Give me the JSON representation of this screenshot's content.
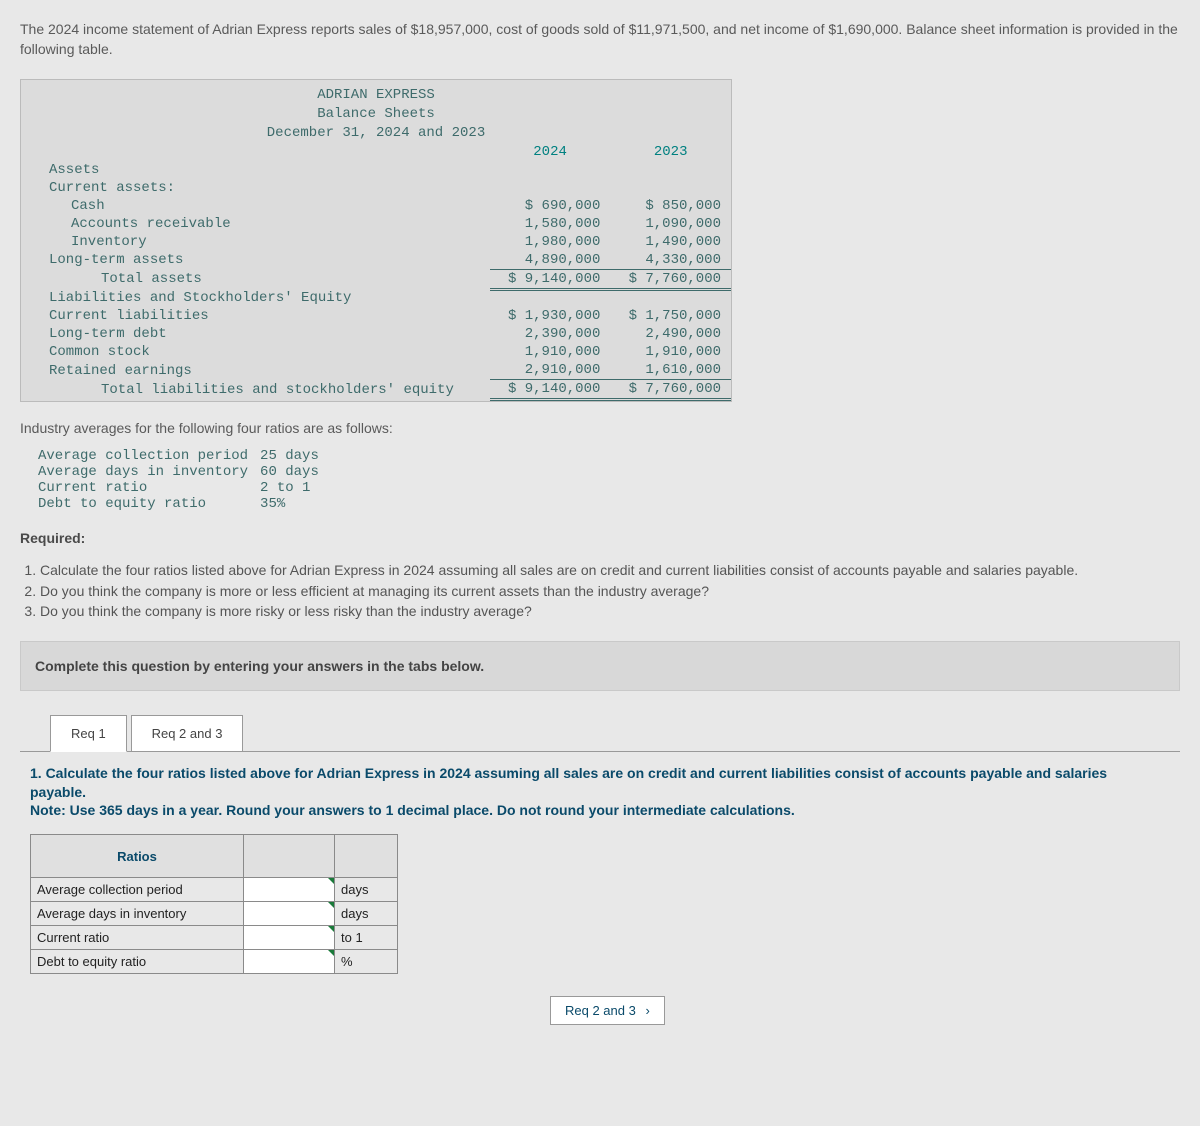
{
  "intro": "The 2024 income statement of Adrian Express reports sales of $18,957,000, cost of goods sold of $11,971,500, and net income of $1,690,000. Balance sheet information is provided in the following table.",
  "balance_sheet": {
    "title1": "ADRIAN EXPRESS",
    "title2": "Balance Sheets",
    "title3": "December 31, 2024 and 2023",
    "col_2024": "2024",
    "col_2023": "2023",
    "assets_h": "Assets",
    "ca_h": "Current assets:",
    "cash": {
      "label": "Cash",
      "y24": "$ 690,000",
      "y23": "$ 850,000"
    },
    "ar": {
      "label": "Accounts receivable",
      "y24": "1,580,000",
      "y23": "1,090,000"
    },
    "inv": {
      "label": "Inventory",
      "y24": "1,980,000",
      "y23": "1,490,000"
    },
    "lta": {
      "label": "Long-term assets",
      "y24": "4,890,000",
      "y23": "4,330,000"
    },
    "ta": {
      "label": "Total assets",
      "y24": "$ 9,140,000",
      "y23": "$ 7,760,000"
    },
    "liab_h": "Liabilities and Stockholders' Equity",
    "cl": {
      "label": "Current liabilities",
      "y24": "$ 1,930,000",
      "y23": "$ 1,750,000"
    },
    "ltd": {
      "label": "Long-term debt",
      "y24": "2,390,000",
      "y23": "2,490,000"
    },
    "cs": {
      "label": "Common stock",
      "y24": "1,910,000",
      "y23": "1,910,000"
    },
    "re": {
      "label": "Retained earnings",
      "y24": "2,910,000",
      "y23": "1,610,000"
    },
    "tle": {
      "label": "Total liabilities and stockholders' equity",
      "y24": "$ 9,140,000",
      "y23": "$ 7,760,000"
    }
  },
  "avg_intro": "Industry averages for the following four ratios are as follows:",
  "averages": [
    {
      "label": "Average collection period",
      "val": "25 days"
    },
    {
      "label": "Average days in inventory",
      "val": "60 days"
    },
    {
      "label": "Current ratio",
      "val": "2 to 1"
    },
    {
      "label": "Debt to equity ratio",
      "val": "35%"
    }
  ],
  "required_h": "Required:",
  "required": [
    "Calculate the four ratios listed above for Adrian Express in 2024 assuming all sales are on credit and current liabilities consist of accounts payable and salaries payable.",
    "Do you think the company is more or less efficient at managing its current assets than the industry average?",
    "Do you think the company is more risky or less risky than the industry average?"
  ],
  "complete_instr": "Complete this question by entering your answers in the tabs below.",
  "tabs": {
    "t1": "Req 1",
    "t2": "Req 2 and 3"
  },
  "req1_text": "1. Calculate the four ratios listed above for Adrian Express in 2024 assuming all sales are on credit and current liabilities consist of accounts payable and salaries payable.",
  "req1_note": "Note: Use 365 days in a year. Round your answers to 1 decimal place. Do not round your intermediate calculations.",
  "ratios_header": "Ratios",
  "ratio_rows": [
    {
      "label": "Average collection period",
      "unit": "days"
    },
    {
      "label": "Average days in inventory",
      "unit": "days"
    },
    {
      "label": "Current ratio",
      "unit": "to 1"
    },
    {
      "label": "Debt to equity ratio",
      "unit": "%"
    }
  ],
  "nav_next": "Req 2 and 3"
}
